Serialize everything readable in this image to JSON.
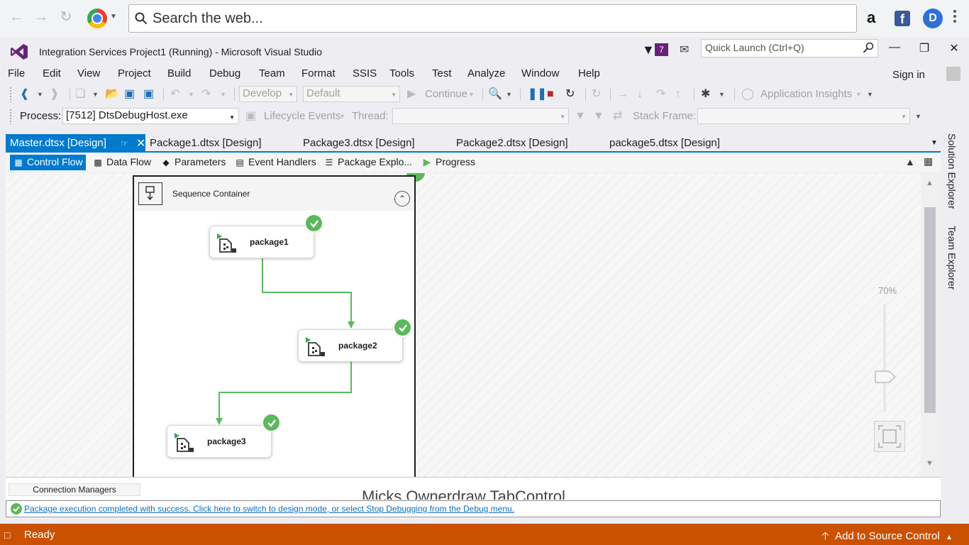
{
  "browser": {
    "search_placeholder": "Search the web...",
    "ext_amazon": "a",
    "ext_facebook": "f",
    "ext_d": "D"
  },
  "title_bar": {
    "title": "Integration Services Project1 (Running) - Microsoft Visual Studio",
    "notification_count": "7",
    "quick_launch_placeholder": "Quick Launch (Ctrl+Q)"
  },
  "menu": {
    "items": [
      "File",
      "Edit",
      "View",
      "Project",
      "Build",
      "Debug",
      "Team",
      "Format",
      "SSIS",
      "Tools",
      "Test",
      "Analyze",
      "Window",
      "Help"
    ],
    "sign_in": "Sign in"
  },
  "toolbar1": {
    "config_combo": "Develop",
    "platform_combo": "Default",
    "continue_label": "Continue",
    "app_insights": "Application Insights"
  },
  "toolbar2": {
    "process_label": "Process:",
    "process_value": "[7512] DtsDebugHost.exe",
    "lifecycle_label": "Lifecycle Events",
    "thread_label": "Thread:",
    "stack_frame_label": "Stack Frame:"
  },
  "doc_tabs": [
    "Master.dtsx [Design]",
    "Package1.dtsx [Design]",
    "Package3.dtsx [Design]",
    "Package2.dtsx [Design]",
    "package5.dtsx [Design]"
  ],
  "design_tabs": [
    "Control Flow",
    "Data Flow",
    "Parameters",
    "Event Handlers",
    "Package Explo...",
    "Progress"
  ],
  "canvas": {
    "container_title": "Sequence Container",
    "tasks": [
      "package1",
      "package2",
      "package3"
    ],
    "zoom": "70%"
  },
  "bottom": {
    "connection_managers": "Connection Managers",
    "owner_text": "Micks Ownerdraw TabControl",
    "message": "Package execution completed with success. Click here to switch to design mode, or select Stop Debugging from the Debug menu."
  },
  "side_panel": {
    "solution_explorer": "Solution Explorer",
    "team_explorer": "Team Explorer"
  },
  "status": {
    "ready": "Ready",
    "source_control": "Add to Source Control"
  },
  "colors": {
    "accent": "#007acc",
    "status_bar": "#ca5100",
    "success": "#5cb85c",
    "vs_purple": "#68217a"
  }
}
